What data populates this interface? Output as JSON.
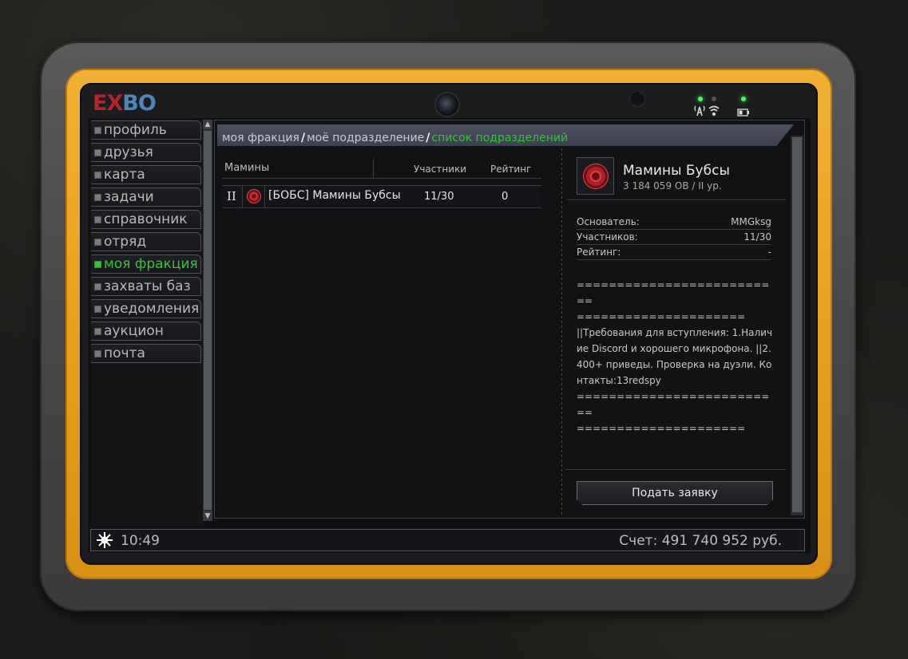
{
  "brand": {
    "logo_left": "EX",
    "logo_right": "BO"
  },
  "sidebar": {
    "items": [
      {
        "label": "профиль",
        "active": false
      },
      {
        "label": "друзья",
        "active": false
      },
      {
        "label": "карта",
        "active": false
      },
      {
        "label": "задачи",
        "active": false
      },
      {
        "label": "справочник",
        "active": false
      },
      {
        "label": "отряд",
        "active": false
      },
      {
        "label": "моя фракция",
        "active": true
      },
      {
        "label": "захваты баз",
        "active": false
      },
      {
        "label": "уведомления",
        "active": false
      },
      {
        "label": "аукцион",
        "active": false
      },
      {
        "label": "почта",
        "active": false
      }
    ]
  },
  "breadcrumb": {
    "items": [
      "моя фракция",
      "моё подразделение"
    ],
    "current": "список подразделений",
    "separator": "/"
  },
  "list": {
    "columns": {
      "name": "Мамины",
      "members": "Участники",
      "rating": "Рейтинг"
    },
    "rows": [
      {
        "rank": "II",
        "name": "[БОБС] Мамины Бубсы",
        "members": "11/30",
        "rating": "0"
      }
    ]
  },
  "detail": {
    "title": "Мамины Бубсы",
    "subtitle": "3 184 059 ОВ / II ур.",
    "info": [
      {
        "label": "Основатель:",
        "value": "MMGksg"
      },
      {
        "label": "Участников:",
        "value": "11/30"
      },
      {
        "label": "Рейтинг:",
        "value": "-"
      }
    ],
    "description": "==========================\n=====================\n||Требования для вступления: 1.Наличие Discord и хорошего микрофона. ||2.400+ приведы. Проверка на дуэли. Контакты:13redspy\n==========================\n=====================",
    "apply_label": "Подать заявку"
  },
  "status_bar": {
    "time": "10:49",
    "balance": "Счет: 491 740 952 руб."
  },
  "colors": {
    "accent_green": "#32c43a",
    "device_yellow": "#e7a11f",
    "emblem_red": "#b01f24"
  }
}
